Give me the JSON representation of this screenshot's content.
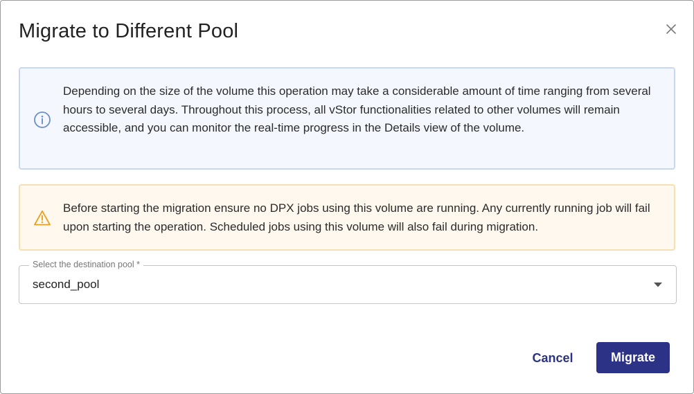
{
  "dialog": {
    "title": "Migrate to Different Pool",
    "close_icon": "close-icon"
  },
  "info_alert": {
    "icon": "info-circle-icon",
    "text": "Depending on the size of the volume this operation may take a considerable amount of time ranging from several hours to several days. Throughout this process, all vStor functionalities related to other volumes will remain accessible, and you can monitor the real-time progress in the Details view of the volume."
  },
  "warning_alert": {
    "icon": "warning-triangle-icon",
    "text": "Before starting the migration ensure no DPX jobs using this volume are running. Any currently running job will fail upon starting the operation. Scheduled jobs using this volume will also fail during migration."
  },
  "pool_select": {
    "label": "Select the destination pool *",
    "value": "second_pool",
    "icon": "caret-down-icon"
  },
  "actions": {
    "cancel_label": "Cancel",
    "migrate_label": "Migrate"
  },
  "colors": {
    "primary": "#2c3286",
    "info_bg": "#f4f7fd",
    "info_border": "#c9d8f0",
    "info_icon": "#6a8fc7",
    "warn_bg": "#fff8ee",
    "warn_border": "#f7dfb4",
    "warn_icon": "#e8a020"
  }
}
